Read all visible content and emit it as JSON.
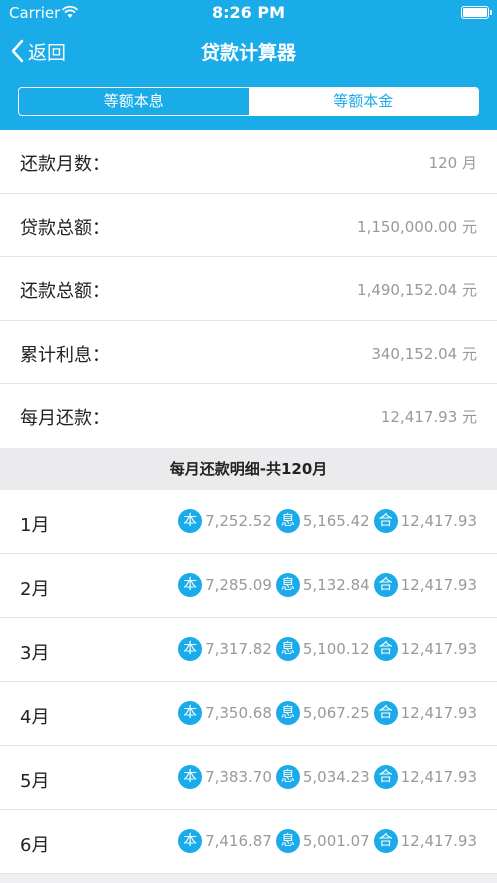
{
  "status_bar": {
    "carrier": "Carrier",
    "time": "8:26 PM"
  },
  "nav": {
    "back_label": "返回",
    "title": "贷款计算器"
  },
  "tabs": [
    {
      "label": "等额本息",
      "active": true
    },
    {
      "label": "等额本金",
      "active": false
    }
  ],
  "summary": [
    {
      "label": "还款月数：",
      "value": "120 月"
    },
    {
      "label": "贷款总额：",
      "value": "1,150,000.00 元"
    },
    {
      "label": "还款总额：",
      "value": "1,490,152.04 元"
    },
    {
      "label": "累计利息：",
      "value": "340,152.04 元"
    },
    {
      "label": "每月还款：",
      "value": "12,417.93 元"
    }
  ],
  "section_header": "每月还款明细-共120月",
  "badges": {
    "principal": "本",
    "interest": "息",
    "total": "合"
  },
  "months": [
    {
      "month": "1月",
      "principal": "7,252.52",
      "interest": "5,165.42",
      "total": "12,417.93"
    },
    {
      "month": "2月",
      "principal": "7,285.09",
      "interest": "5,132.84",
      "total": "12,417.93"
    },
    {
      "month": "3月",
      "principal": "7,317.82",
      "interest": "5,100.12",
      "total": "12,417.93"
    },
    {
      "month": "4月",
      "principal": "7,350.68",
      "interest": "5,067.25",
      "total": "12,417.93"
    },
    {
      "month": "5月",
      "principal": "7,383.70",
      "interest": "5,034.23",
      "total": "12,417.93"
    },
    {
      "month": "6月",
      "principal": "7,416.87",
      "interest": "5,001.07",
      "total": "12,417.93"
    }
  ],
  "colors": {
    "accent": "#1aabe9",
    "muted_text": "#999999"
  }
}
